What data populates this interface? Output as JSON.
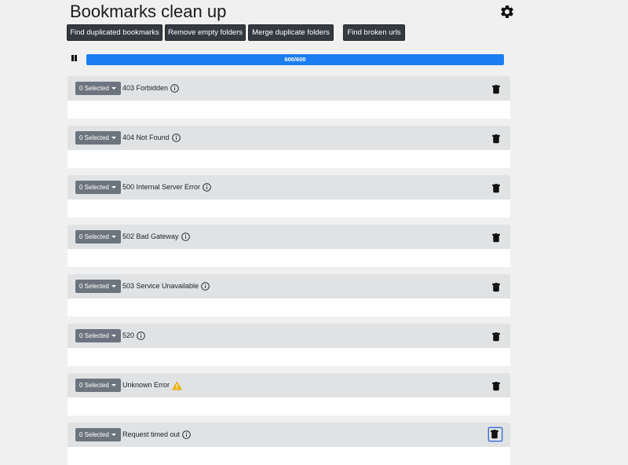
{
  "page": {
    "title": "Bookmarks clean up"
  },
  "toolbar": {
    "buttons": [
      "Find duplicated bookmarks",
      "Remove empty folders",
      "Merge duplicate folders",
      "Find broken urls"
    ]
  },
  "progress": {
    "text": "600/600",
    "fraction": 1.0
  },
  "groups": [
    {
      "selected": "0 Selected",
      "title": "403 Forbidden",
      "icon": "info-icon"
    },
    {
      "selected": "0 Selected",
      "title": "404 Not Found",
      "icon": "info-icon"
    },
    {
      "selected": "0 Selected",
      "title": "500 Internal Server Error",
      "icon": "info-icon"
    },
    {
      "selected": "0 Selected",
      "title": "502 Bad Gateway",
      "icon": "info-icon"
    },
    {
      "selected": "0 Selected",
      "title": "503 Service Unavailable",
      "icon": "info-icon"
    },
    {
      "selected": "0 Selected",
      "title": "520",
      "icon": "info-icon"
    },
    {
      "selected": "0 Selected",
      "title": "Unknown Error",
      "icon": "warning-icon"
    },
    {
      "selected": "0 Selected",
      "title": "Request timed out",
      "icon": "info-icon"
    }
  ],
  "colors": {
    "accent": "#1a7ef2",
    "dark_button": "#343a40",
    "secondary_button": "#6c757d",
    "warning": "#f0b400"
  }
}
